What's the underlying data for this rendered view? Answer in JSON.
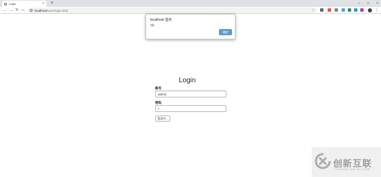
{
  "browser": {
    "tab_title": "Login",
    "new_tab": "+",
    "tab_close": "×",
    "url_host": "localhost",
    "url_path": "/user/login.html",
    "controls": {
      "minimize": "–",
      "maximize": "□",
      "close": "×"
    },
    "extension_colors": [
      "#6a6a6a",
      "#e8593a",
      "#888888",
      "#4aa7d8",
      "#3f8f5f",
      "#2e9bd6",
      "#b23fb8"
    ]
  },
  "dialog": {
    "title": "localhost 显示",
    "message": "Ok",
    "ok_label": "确定",
    "ok_color": "#5b9bd5"
  },
  "login": {
    "title": "Login",
    "username_label": "账号",
    "username_value": "admin",
    "password_label": "密码",
    "password_value": "•",
    "submit_label": "登录中..."
  },
  "watermark": {
    "brand_cn": "创新互联",
    "brand_en": "CHUANG XIN HU LIAN"
  }
}
